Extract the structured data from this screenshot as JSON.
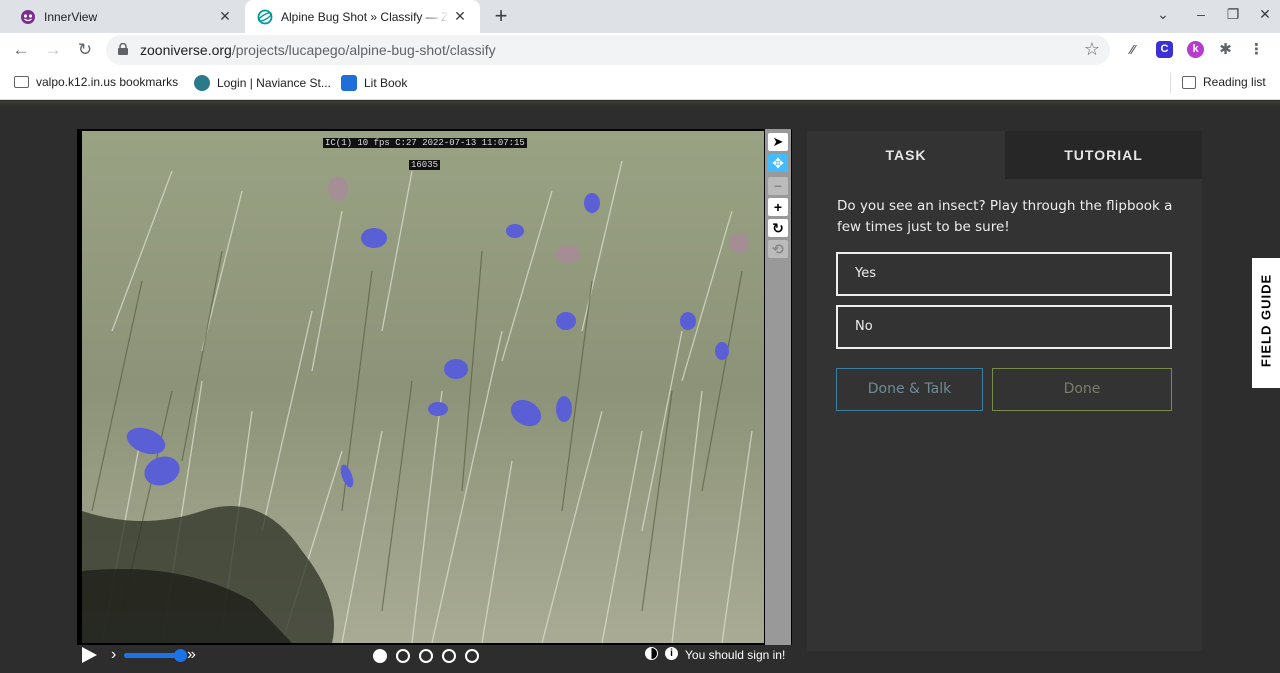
{
  "browser": {
    "tabs": [
      {
        "title": "InnerView",
        "active": false
      },
      {
        "title": "Alpine Bug Shot » Classify — Zoo",
        "active": true
      }
    ],
    "url_host": "zooniverse.org",
    "url_path": "/projects/lucapego/alpine-bug-shot/classify",
    "bookmarks": [
      {
        "label": "valpo.k12.in.us bookmarks",
        "icon": "folder-icon"
      },
      {
        "label": "Login | Naviance St...",
        "icon": "naviance-icon"
      },
      {
        "label": "Lit Book",
        "icon": "litbook-icon"
      }
    ],
    "reading_list": "Reading list",
    "extensions": [
      "C",
      "k"
    ]
  },
  "viewer": {
    "overlay_line1": "IC(1)  10 fps  C:27  2022-07-13  11:07:15",
    "overlay_line2": "16035",
    "frame_count": 5,
    "selected_frame": 1,
    "playback_speed_fraction": 0.9,
    "signin_text": "You should sign in!"
  },
  "panel": {
    "tab_task": "TASK",
    "tab_tutorial": "TUTORIAL",
    "question": "Do you see an insect? Play through the flipbook a few times just to be sure!",
    "answers": [
      "Yes",
      "No"
    ],
    "done_talk": "Done & Talk",
    "done": "Done"
  },
  "field_guide": "FIELD GUIDE",
  "colors": {
    "page_bg": "#2d2d2d",
    "panel_bg": "#333333",
    "tool_active": "#43bbfd",
    "slider": "#1a73e8"
  }
}
